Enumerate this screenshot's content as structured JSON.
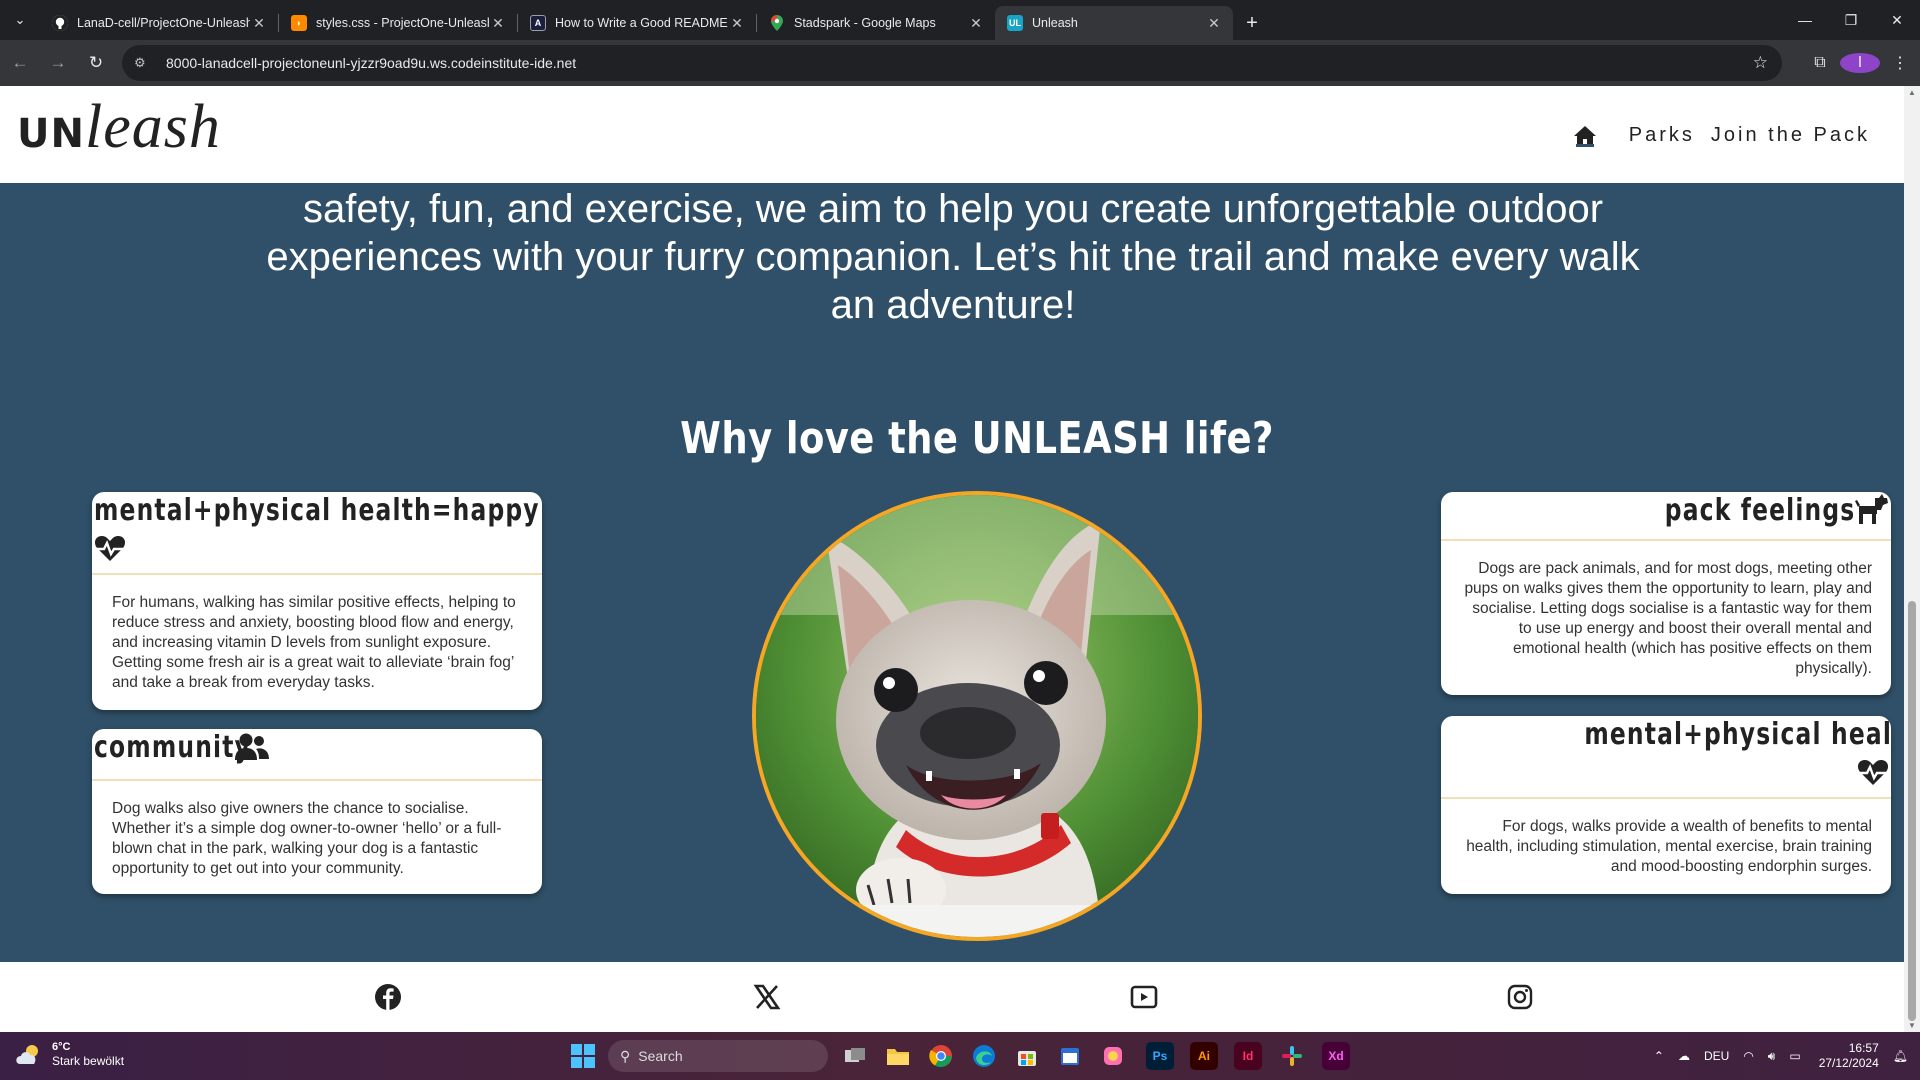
{
  "browser": {
    "tabs": [
      {
        "title": "LanaD-cell/ProjectOne-Unleash",
        "favicon": "github-icon",
        "active": false
      },
      {
        "title": "styles.css - ProjectOne-Unleash",
        "favicon": "gitpod-icon",
        "active": false
      },
      {
        "title": "How to Write a Good README",
        "favicon": "docs-icon",
        "active": false
      },
      {
        "title": "Stadspark - Google Maps",
        "favicon": "maps-pin-icon",
        "active": false
      },
      {
        "title": "Unleash",
        "favicon": "unleash-icon",
        "active": true
      }
    ],
    "address": "8000-lanadcell-projectoneunl-yjzzr9oad9u.ws.codeinstitute-ide.net",
    "profile_initial": "I",
    "tab_favicons_text": {
      "docs": "A",
      "unleash": "UL"
    }
  },
  "header": {
    "logo_un": "UN",
    "logo_leash": "leash",
    "nav": [
      "Parks",
      "Join the Pack"
    ]
  },
  "intro_text": "safety, fun, and exercise, we aim to help you create unforgettable outdoor experiences with your furry companion. Let’s hit the trail and make every walk an adventure!",
  "why": {
    "heading": "Why love the UNLEASH life?",
    "cards": [
      {
        "title": "mental+physical health=happy life",
        "icon": "heart-pulse-icon",
        "body": "For humans, walking has similar positive effects, helping to reduce stress and anxiety, boosting blood flow and energy, and increasing vitamin D levels from sunlight exposure. Getting some fresh air is a great wait to alleviate ‘brain fog’ and take a break from everyday tasks."
      },
      {
        "title": "community",
        "icon": "users-icon",
        "body": "Dog walks also give owners the chance to socialise. Whether it’s a simple dog owner-to-owner ‘hello’ or a full-blown chat in the park, walking your dog is a fantastic opportunity to get out into your community."
      },
      {
        "title": "pack feelings",
        "icon": "dog-icon",
        "body": "Dogs are pack animals, and for most dogs, meeting other pups on walks gives them the opportunity to learn, play and socialise. Letting dogs socialise is a fantastic way for them to use up energy and boost their overall mental and emotional health (which has positive effects on them physically)."
      },
      {
        "title": "mental+physical health=happy dog",
        "icon": "heart-pulse-icon",
        "body": "For dogs, walks provide a wealth of benefits to mental health, including stimulation, mental exercise, brain training and mood-boosting endorphin surges."
      }
    ]
  },
  "footer": {
    "social_icons": [
      "facebook-icon",
      "x-icon",
      "youtube-icon",
      "instagram-icon"
    ]
  },
  "taskbar": {
    "weather_temp": "6°C",
    "weather_desc": "Stark bewölkt",
    "search_placeholder": "Search",
    "apps": [
      {
        "name": "ps",
        "label": "Ps",
        "color": "#31a8ff",
        "bg": "#001e36"
      },
      {
        "name": "ai",
        "label": "Ai",
        "color": "#ff9a00",
        "bg": "#330000"
      },
      {
        "name": "id",
        "label": "Id",
        "color": "#ff3366",
        "bg": "#49021f"
      },
      {
        "name": "xd",
        "label": "Xd",
        "color": "#ff61f6",
        "bg": "#470137"
      }
    ],
    "language": "DEU",
    "time": "16:57",
    "date": "27/12/2024"
  },
  "colors": {
    "page_bg": "#2f5068",
    "accent_orange": "#f5a623",
    "card_divider": "#f3dfb6"
  }
}
